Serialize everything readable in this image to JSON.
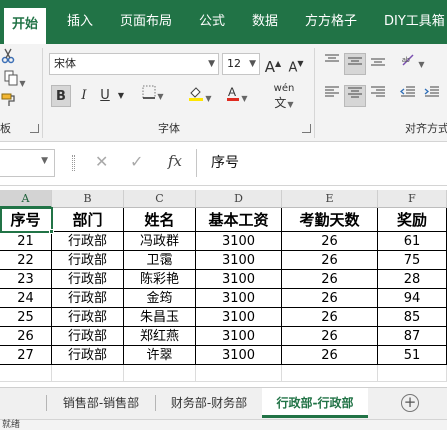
{
  "ribbon_tabs": [
    "开始",
    "插入",
    "页面布局",
    "公式",
    "数据",
    "方方格子",
    "DIY工具箱"
  ],
  "active_tab_index": 0,
  "ribbon": {
    "font_name": "宋体",
    "font_size": "12",
    "grow_font": "A",
    "shrink_font": "A",
    "bold": "B",
    "italic": "I",
    "underline": "U",
    "wen": "wén",
    "font_group_label": "字体",
    "clipboard_label": "板",
    "align_group_label": "对齐方式"
  },
  "formula_bar": {
    "name_box": "",
    "fx": "fx",
    "content": "序号"
  },
  "columns": [
    "A",
    "B",
    "C",
    "D",
    "E",
    "F"
  ],
  "selected_column": "A",
  "table": {
    "headers": [
      "序号",
      "部门",
      "姓名",
      "基本工资",
      "考勤天数",
      "奖励"
    ],
    "rows": [
      [
        "21",
        "行政部",
        "冯政群",
        "3100",
        "26",
        "61"
      ],
      [
        "22",
        "行政部",
        "卫霭",
        "3100",
        "26",
        "75"
      ],
      [
        "23",
        "行政部",
        "陈彩艳",
        "3100",
        "26",
        "28"
      ],
      [
        "24",
        "行政部",
        "金筠",
        "3100",
        "26",
        "94"
      ],
      [
        "25",
        "行政部",
        "朱昌玉",
        "3100",
        "26",
        "85"
      ],
      [
        "26",
        "行政部",
        "郑红燕",
        "3100",
        "26",
        "87"
      ],
      [
        "27",
        "行政部",
        "许翠",
        "3100",
        "26",
        "51"
      ]
    ]
  },
  "sheet_tabs": [
    "销售部-销售部",
    "财务部-财务部",
    "行政部-行政部"
  ],
  "active_sheet_index": 2,
  "add_sheet": "+",
  "status_text": "就绪",
  "colors": {
    "accent": "#217346",
    "font_color": "#e02b20",
    "highlight": "#ffe600"
  }
}
